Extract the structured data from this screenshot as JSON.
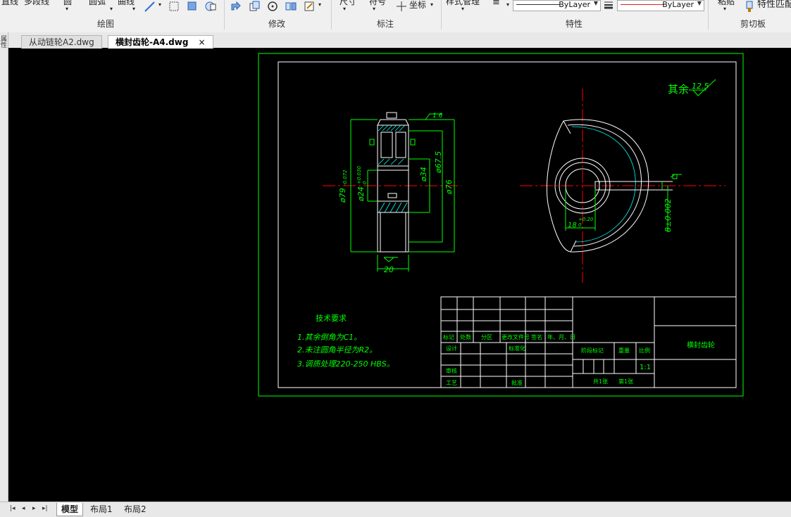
{
  "ribbon": {
    "top_labels": [
      "直线",
      "多段线",
      "圆",
      "圆弧",
      "曲线",
      "尺寸",
      "符号",
      "坐标",
      "样式管理",
      "粘贴",
      "特性匹配"
    ],
    "panels": [
      "绘图",
      "修改",
      "标注",
      "特性",
      "剪切板"
    ],
    "linetype_value": "ByLayer",
    "lineweight_value": "ByLayer"
  },
  "doc_tabs": [
    {
      "label": "从动链轮A2.dwg",
      "active": false
    },
    {
      "label": "横封齿轮-A4.dwg",
      "active": true
    }
  ],
  "close_symbol": "×",
  "left_palette_label": "属性",
  "layout_tabs": [
    "模型",
    "布局1",
    "布局2"
  ],
  "nav_buttons": [
    "|◂",
    "◂",
    "▸",
    "▸|"
  ],
  "drawing": {
    "roughness_prefix": "其余",
    "roughness_value": "12.5",
    "dims": {
      "width_20": "20",
      "d79": "ø79",
      "d79_tol": "-0.072",
      "d24": "ø24",
      "d24_tol_up": "+0.030",
      "d24_tol_low": "0",
      "d34": "ø34",
      "d67_5": "ø67.5",
      "d76": "ø76",
      "ra16": "1.6",
      "keyway_depth": "18",
      "keyway_tol": "+0.20",
      "keyway_tol_low": "0",
      "key_width": "8±0.002"
    },
    "tech": {
      "title": "技术要求",
      "items": [
        "1.其余倒角为C1。",
        "2.未注圆角半径为R2。",
        "3.调质处理220-250 HBS。"
      ]
    },
    "titleblock": {
      "headers": [
        "标记",
        "处数",
        "分区",
        "更改文件号",
        "签名",
        "年、月、日"
      ],
      "design": "设计",
      "standardization": "标准化",
      "review": "审核",
      "process": "工艺",
      "approve": "批准",
      "stage_mark": "阶段标记",
      "weight": "重量",
      "scale": "比例",
      "scale_value": "1:1",
      "total_sheets": "共1张",
      "sheet_no": "第1张",
      "part_name": "横封齿轮"
    }
  },
  "colors": {
    "ribbon_bg": "#f0f0f0",
    "canvas_bg": "#000000",
    "drawing_white": "#ffffff",
    "dim_green": "#00ff00",
    "center_red": "#ff0000",
    "hatch_cyan": "#00ffff"
  }
}
